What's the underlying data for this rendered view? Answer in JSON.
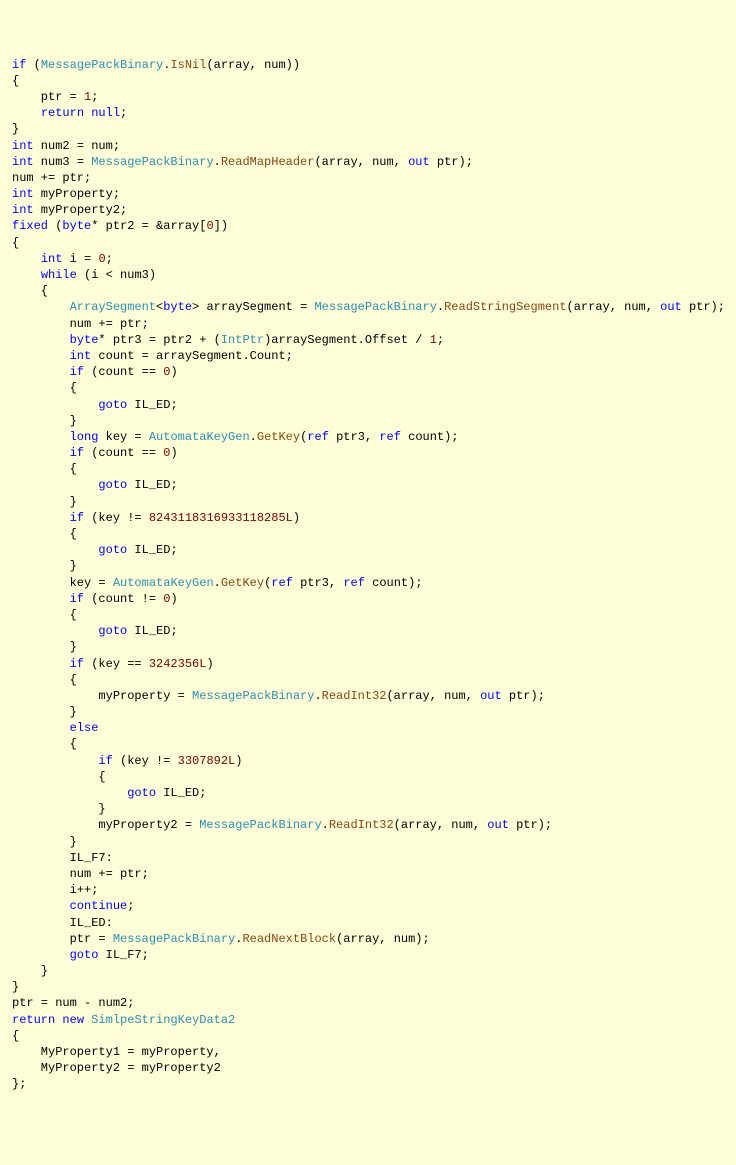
{
  "tokens": [
    [
      {
        "c": "kw",
        "t": "if"
      },
      {
        "t": " ("
      },
      {
        "c": "type",
        "t": "MessagePackBinary"
      },
      {
        "t": "."
      },
      {
        "c": "method",
        "t": "IsNil"
      },
      {
        "t": "(array, num))"
      }
    ],
    [
      {
        "t": "{"
      }
    ],
    [
      {
        "t": "    ptr = "
      },
      {
        "c": "num",
        "t": "1"
      },
      {
        "t": ";"
      }
    ],
    [
      {
        "t": "    "
      },
      {
        "c": "kw",
        "t": "return"
      },
      {
        "t": " "
      },
      {
        "c": "kw",
        "t": "null"
      },
      {
        "t": ";"
      }
    ],
    [
      {
        "t": "}"
      }
    ],
    [
      {
        "c": "kw",
        "t": "int"
      },
      {
        "t": " num2 = num;"
      }
    ],
    [
      {
        "c": "kw",
        "t": "int"
      },
      {
        "t": " num3 = "
      },
      {
        "c": "type",
        "t": "MessagePackBinary"
      },
      {
        "t": "."
      },
      {
        "c": "method",
        "t": "ReadMapHeader"
      },
      {
        "t": "(array, num, "
      },
      {
        "c": "kw",
        "t": "out"
      },
      {
        "t": " ptr);"
      }
    ],
    [
      {
        "t": "num += ptr;"
      }
    ],
    [
      {
        "c": "kw",
        "t": "int"
      },
      {
        "t": " myProperty;"
      }
    ],
    [
      {
        "c": "kw",
        "t": "int"
      },
      {
        "t": " myProperty2;"
      }
    ],
    [
      {
        "c": "kw",
        "t": "fixed"
      },
      {
        "t": " ("
      },
      {
        "c": "kw",
        "t": "byte"
      },
      {
        "t": "* ptr2 = &array["
      },
      {
        "c": "num",
        "t": "0"
      },
      {
        "t": "])"
      }
    ],
    [
      {
        "t": "{"
      }
    ],
    [
      {
        "t": "    "
      },
      {
        "c": "kw",
        "t": "int"
      },
      {
        "t": " i = "
      },
      {
        "c": "num",
        "t": "0"
      },
      {
        "t": ";"
      }
    ],
    [
      {
        "t": "    "
      },
      {
        "c": "kw",
        "t": "while"
      },
      {
        "t": " (i < num3)"
      }
    ],
    [
      {
        "t": "    {"
      }
    ],
    [
      {
        "t": "        "
      },
      {
        "c": "type",
        "t": "ArraySegment"
      },
      {
        "t": "<"
      },
      {
        "c": "kw",
        "t": "byte"
      },
      {
        "t": "> arraySegment = "
      },
      {
        "c": "type",
        "t": "MessagePackBinary"
      },
      {
        "t": "."
      },
      {
        "c": "method",
        "t": "ReadStringSegment"
      },
      {
        "t": "(array, num, "
      },
      {
        "c": "kw",
        "t": "out"
      },
      {
        "t": " ptr);"
      }
    ],
    [
      {
        "t": "        num += ptr;"
      }
    ],
    [
      {
        "t": "        "
      },
      {
        "c": "kw",
        "t": "byte"
      },
      {
        "t": "* ptr3 = ptr2 + ("
      },
      {
        "c": "type",
        "t": "IntPtr"
      },
      {
        "t": ")arraySegment.Offset / "
      },
      {
        "c": "num",
        "t": "1"
      },
      {
        "t": ";"
      }
    ],
    [
      {
        "t": "        "
      },
      {
        "c": "kw",
        "t": "int"
      },
      {
        "t": " count = arraySegment.Count;"
      }
    ],
    [
      {
        "t": "        "
      },
      {
        "c": "kw",
        "t": "if"
      },
      {
        "t": " (count == "
      },
      {
        "c": "num",
        "t": "0"
      },
      {
        "t": ")"
      }
    ],
    [
      {
        "t": "        {"
      }
    ],
    [
      {
        "t": "            "
      },
      {
        "c": "kw",
        "t": "goto"
      },
      {
        "t": " IL_ED;"
      }
    ],
    [
      {
        "t": "        }"
      }
    ],
    [
      {
        "t": "        "
      },
      {
        "c": "kw",
        "t": "long"
      },
      {
        "t": " key = "
      },
      {
        "c": "type",
        "t": "AutomataKeyGen"
      },
      {
        "t": "."
      },
      {
        "c": "method",
        "t": "GetKey"
      },
      {
        "t": "("
      },
      {
        "c": "kw",
        "t": "ref"
      },
      {
        "t": " ptr3, "
      },
      {
        "c": "kw",
        "t": "ref"
      },
      {
        "t": " count);"
      }
    ],
    [
      {
        "t": "        "
      },
      {
        "c": "kw",
        "t": "if"
      },
      {
        "t": " (count == "
      },
      {
        "c": "num",
        "t": "0"
      },
      {
        "t": ")"
      }
    ],
    [
      {
        "t": "        {"
      }
    ],
    [
      {
        "t": "            "
      },
      {
        "c": "kw",
        "t": "goto"
      },
      {
        "t": " IL_ED;"
      }
    ],
    [
      {
        "t": "        }"
      }
    ],
    [
      {
        "t": "        "
      },
      {
        "c": "kw",
        "t": "if"
      },
      {
        "t": " (key != "
      },
      {
        "c": "num",
        "t": "8243118316933118285L"
      },
      {
        "t": ")"
      }
    ],
    [
      {
        "t": "        {"
      }
    ],
    [
      {
        "t": "            "
      },
      {
        "c": "kw",
        "t": "goto"
      },
      {
        "t": " IL_ED;"
      }
    ],
    [
      {
        "t": "        }"
      }
    ],
    [
      {
        "t": "        key = "
      },
      {
        "c": "type",
        "t": "AutomataKeyGen"
      },
      {
        "t": "."
      },
      {
        "c": "method",
        "t": "GetKey"
      },
      {
        "t": "("
      },
      {
        "c": "kw",
        "t": "ref"
      },
      {
        "t": " ptr3, "
      },
      {
        "c": "kw",
        "t": "ref"
      },
      {
        "t": " count);"
      }
    ],
    [
      {
        "t": "        "
      },
      {
        "c": "kw",
        "t": "if"
      },
      {
        "t": " (count != "
      },
      {
        "c": "num",
        "t": "0"
      },
      {
        "t": ")"
      }
    ],
    [
      {
        "t": "        {"
      }
    ],
    [
      {
        "t": "            "
      },
      {
        "c": "kw",
        "t": "goto"
      },
      {
        "t": " IL_ED;"
      }
    ],
    [
      {
        "t": "        }"
      }
    ],
    [
      {
        "t": "        "
      },
      {
        "c": "kw",
        "t": "if"
      },
      {
        "t": " (key == "
      },
      {
        "c": "num",
        "t": "3242356L"
      },
      {
        "t": ")"
      }
    ],
    [
      {
        "t": "        {"
      }
    ],
    [
      {
        "t": "            myProperty = "
      },
      {
        "c": "type",
        "t": "MessagePackBinary"
      },
      {
        "t": "."
      },
      {
        "c": "method",
        "t": "ReadInt32"
      },
      {
        "t": "(array, num, "
      },
      {
        "c": "kw",
        "t": "out"
      },
      {
        "t": " ptr);"
      }
    ],
    [
      {
        "t": "        }"
      }
    ],
    [
      {
        "t": "        "
      },
      {
        "c": "kw",
        "t": "else"
      }
    ],
    [
      {
        "t": "        {"
      }
    ],
    [
      {
        "t": "            "
      },
      {
        "c": "kw",
        "t": "if"
      },
      {
        "t": " (key != "
      },
      {
        "c": "num",
        "t": "3307892L"
      },
      {
        "t": ")"
      }
    ],
    [
      {
        "t": "            {"
      }
    ],
    [
      {
        "t": "                "
      },
      {
        "c": "kw",
        "t": "goto"
      },
      {
        "t": " IL_ED;"
      }
    ],
    [
      {
        "t": "            }"
      }
    ],
    [
      {
        "t": "            myProperty2 = "
      },
      {
        "c": "type",
        "t": "MessagePackBinary"
      },
      {
        "t": "."
      },
      {
        "c": "method",
        "t": "ReadInt32"
      },
      {
        "t": "(array, num, "
      },
      {
        "c": "kw",
        "t": "out"
      },
      {
        "t": " ptr);"
      }
    ],
    [
      {
        "t": "        }"
      }
    ],
    [
      {
        "t": "        IL_F7:"
      }
    ],
    [
      {
        "t": "        num += ptr;"
      }
    ],
    [
      {
        "t": "        i++;"
      }
    ],
    [
      {
        "t": "        "
      },
      {
        "c": "kw",
        "t": "continue"
      },
      {
        "t": ";"
      }
    ],
    [
      {
        "t": "        IL_ED:"
      }
    ],
    [
      {
        "t": "        ptr = "
      },
      {
        "c": "type",
        "t": "MessagePackBinary"
      },
      {
        "t": "."
      },
      {
        "c": "method",
        "t": "ReadNextBlock"
      },
      {
        "t": "(array, num);"
      }
    ],
    [
      {
        "t": "        "
      },
      {
        "c": "kw",
        "t": "goto"
      },
      {
        "t": " IL_F7;"
      }
    ],
    [
      {
        "t": "    }"
      }
    ],
    [
      {
        "t": "}"
      }
    ],
    [
      {
        "t": "ptr = num - num2;"
      }
    ],
    [
      {
        "c": "kw",
        "t": "return"
      },
      {
        "t": " "
      },
      {
        "c": "kw",
        "t": "new"
      },
      {
        "t": " "
      },
      {
        "c": "type",
        "t": "SimlpeStringKeyData2"
      }
    ],
    [
      {
        "t": "{"
      }
    ],
    [
      {
        "t": "    MyProperty1 = myProperty,"
      }
    ],
    [
      {
        "t": "    MyProperty2 = myProperty2"
      }
    ],
    [
      {
        "t": "};"
      }
    ]
  ]
}
